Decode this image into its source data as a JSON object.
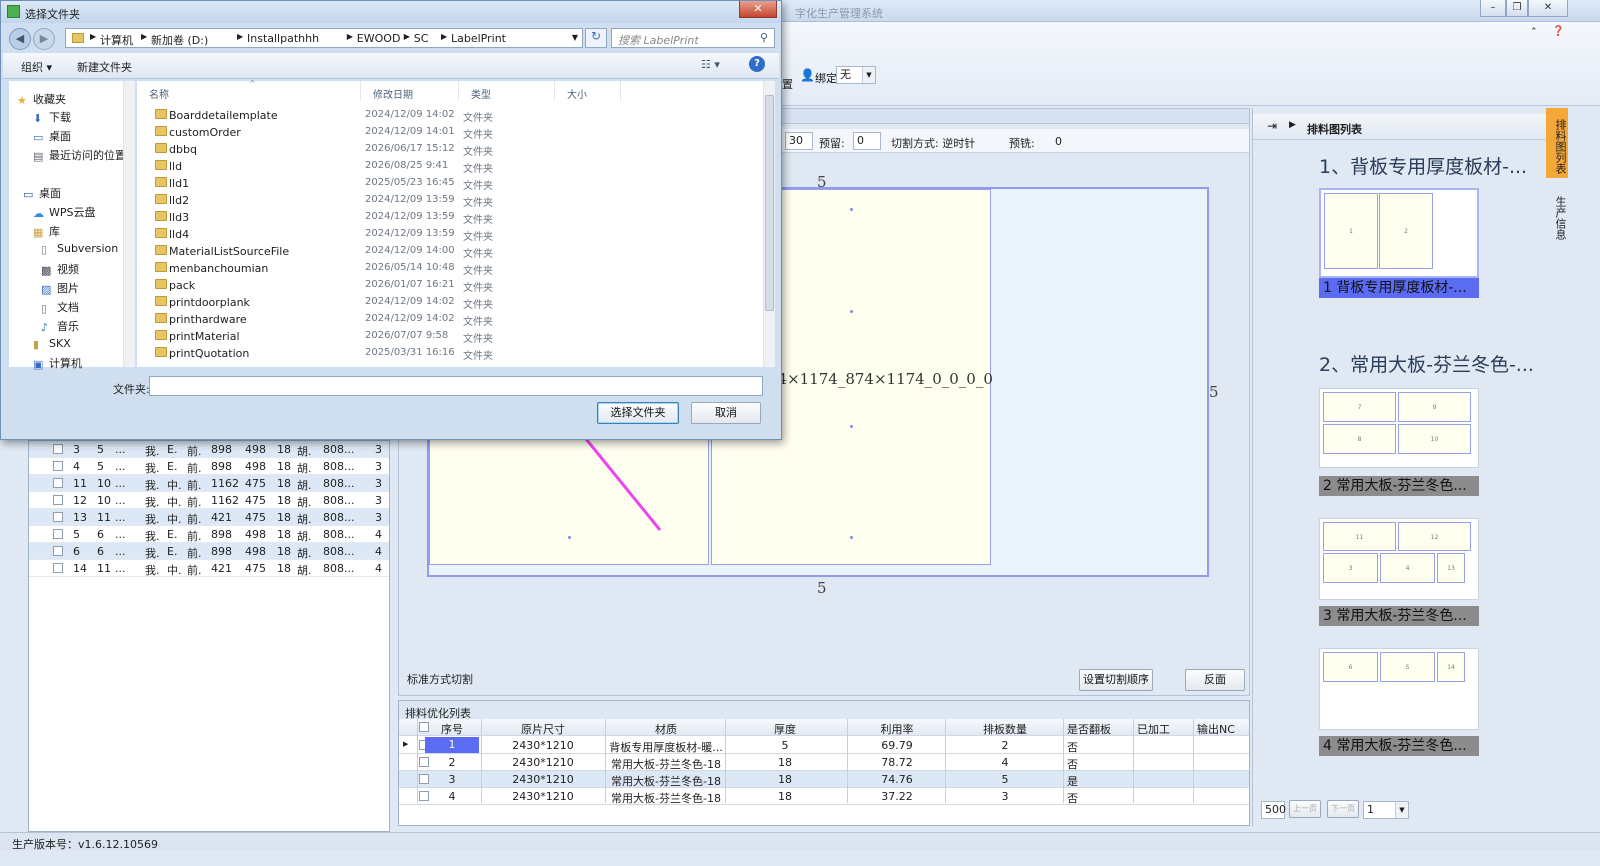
{
  "app": {
    "title": "字化生产管理系统",
    "version_label": "生产版本号：",
    "version": "v1.6.12.10569"
  },
  "ribbon": {
    "bind_label": "绑定",
    "bind_value": "无"
  },
  "canvas_header": {
    "v30": "30",
    "reserve_label": "预留:",
    "reserve_value": "0",
    "cut_label": "切割方式: 逆时针",
    "prefeed_label": "预铣:",
    "prefeed_value": "0"
  },
  "canvas": {
    "part_label": "74×1174_874×1174_0_0_0_0",
    "dim_top": "5",
    "dim_bottom": "5",
    "dim_right": "5",
    "cut_mode": "标准方式切割",
    "set_order_btn": "设置切割顺序",
    "reverse_btn": "反面"
  },
  "left_table": {
    "rows": [
      [
        "3",
        "5",
        "...",
        "我.",
        "E.",
        "前.",
        "898",
        "498",
        "18",
        "胡.",
        "808...",
        "3"
      ],
      [
        "4",
        "5",
        "...",
        "我.",
        "E.",
        "前.",
        "898",
        "498",
        "18",
        "胡.",
        "808...",
        "3"
      ],
      [
        "11",
        "10",
        "...",
        "我.",
        "中.",
        "前.",
        "1162",
        "475",
        "18",
        "胡.",
        "808...",
        "3"
      ],
      [
        "12",
        "10",
        "...",
        "我.",
        "中.",
        "前.",
        "1162",
        "475",
        "18",
        "胡.",
        "808...",
        "3"
      ],
      [
        "13",
        "11",
        "...",
        "我.",
        "中.",
        "前.",
        "421",
        "475",
        "18",
        "胡.",
        "808...",
        "3"
      ],
      [
        "5",
        "6",
        "...",
        "我.",
        "E.",
        "前.",
        "898",
        "498",
        "18",
        "胡.",
        "808...",
        "4"
      ],
      [
        "6",
        "6",
        "...",
        "我.",
        "E.",
        "前.",
        "898",
        "498",
        "18",
        "胡.",
        "808...",
        "4"
      ],
      [
        "14",
        "11",
        "...",
        "我.",
        "中.",
        "前.",
        "421",
        "475",
        "18",
        "胡.",
        "808...",
        "4"
      ]
    ]
  },
  "opt_table": {
    "title": "排料优化列表",
    "headers": [
      "序号",
      "原片尺寸",
      "材质",
      "厚度",
      "利用率",
      "排板数量",
      "是否翻板",
      "已加工",
      "输出NC"
    ],
    "rows": [
      [
        "1",
        "2430*1210",
        "背板专用厚度板材-暖...",
        "5",
        "69.79",
        "2",
        "否",
        "",
        ""
      ],
      [
        "2",
        "2430*1210",
        "常用大板-芬兰冬色-18",
        "18",
        "78.72",
        "4",
        "否",
        "",
        ""
      ],
      [
        "3",
        "2430*1210",
        "常用大板-芬兰冬色-18",
        "18",
        "74.76",
        "5",
        "是",
        "",
        ""
      ],
      [
        "4",
        "2430*1210",
        "常用大板-芬兰冬色-18",
        "18",
        "37.22",
        "3",
        "否",
        "",
        ""
      ]
    ]
  },
  "right_panel": {
    "title": "排料图列表",
    "layouts": [
      {
        "title": "1、背板专用厚度板材-...",
        "label": "1  背板专用厚度板材-..."
      },
      {
        "title": "2、常用大板-芬兰冬色-...",
        "label": "2  常用大板-芬兰冬色..."
      },
      {
        "label": "3  常用大板-芬兰冬色..."
      },
      {
        "label": "4  常用大板-芬兰冬色..."
      }
    ],
    "thumb_parts": {
      "t1": [
        "1",
        "2"
      ],
      "t2": [
        "7",
        "9",
        "8",
        "10"
      ],
      "t3": [
        "11",
        "12",
        "3",
        "4",
        "13"
      ],
      "t4": [
        "6",
        "5",
        "14"
      ]
    },
    "page_size": "500",
    "prev": "上一页",
    "next": "下一页",
    "page": "1"
  },
  "side_tabs": [
    "排料图列表",
    "生产信息"
  ],
  "dialog": {
    "title": "选择文件夹",
    "breadcrumb": [
      "计算机",
      "新加卷 (D:)",
      "Installpathhh",
      "EWOOD",
      "SC",
      "LabelPrint"
    ],
    "search_placeholder": "搜索 LabelPrint",
    "organize": "组织 ▾",
    "new_folder": "新建文件夹",
    "nav": {
      "favorites": "收藏夹",
      "downloads": "下载",
      "desktop1": "桌面",
      "recent": "最近访问的位置",
      "desktop2": "桌面",
      "wps": "WPS云盘",
      "library": "库",
      "subversion": "Subversion",
      "video": "视频",
      "pictures": "图片",
      "documents": "文档",
      "music": "音乐",
      "skx": "SKX",
      "computer": "计算机"
    },
    "columns": {
      "name": "名称",
      "date": "修改日期",
      "type": "类型",
      "size": "大小"
    },
    "files": [
      [
        "Boarddetailemplate",
        "2024/12/09 14:02",
        "文件夹"
      ],
      [
        "customOrder",
        "2024/12/09 14:01",
        "文件夹"
      ],
      [
        "dbbq",
        "2026/06/17 15:12",
        "文件夹"
      ],
      [
        "lld",
        "2026/08/25 9:41",
        "文件夹"
      ],
      [
        "lld1",
        "2025/05/23 16:45",
        "文件夹"
      ],
      [
        "lld2",
        "2024/12/09 13:59",
        "文件夹"
      ],
      [
        "lld3",
        "2024/12/09 13:59",
        "文件夹"
      ],
      [
        "lld4",
        "2024/12/09 13:59",
        "文件夹"
      ],
      [
        "MaterialListSourceFile",
        "2024/12/09 14:00",
        "文件夹"
      ],
      [
        "menbanchoumian",
        "2026/05/14 10:48",
        "文件夹"
      ],
      [
        "pack",
        "2026/01/07 16:21",
        "文件夹"
      ],
      [
        "printdoorplank",
        "2024/12/09 14:02",
        "文件夹"
      ],
      [
        "printhardware",
        "2024/12/09 14:02",
        "文件夹"
      ],
      [
        "printMaterial",
        "2026/07/07 9:58",
        "文件夹"
      ],
      [
        "printQuotation",
        "2025/03/31 16:16",
        "文件夹"
      ]
    ],
    "folder_label": "文件夹:",
    "folder_value": "",
    "select_btn": "选择文件夹",
    "cancel_btn": "取消"
  },
  "colors": {
    "arrow": "#ee44ee",
    "selected_label": "#5b6cf2",
    "part_fill": "#fffff0",
    "sheet_border": "#8f9af0"
  }
}
